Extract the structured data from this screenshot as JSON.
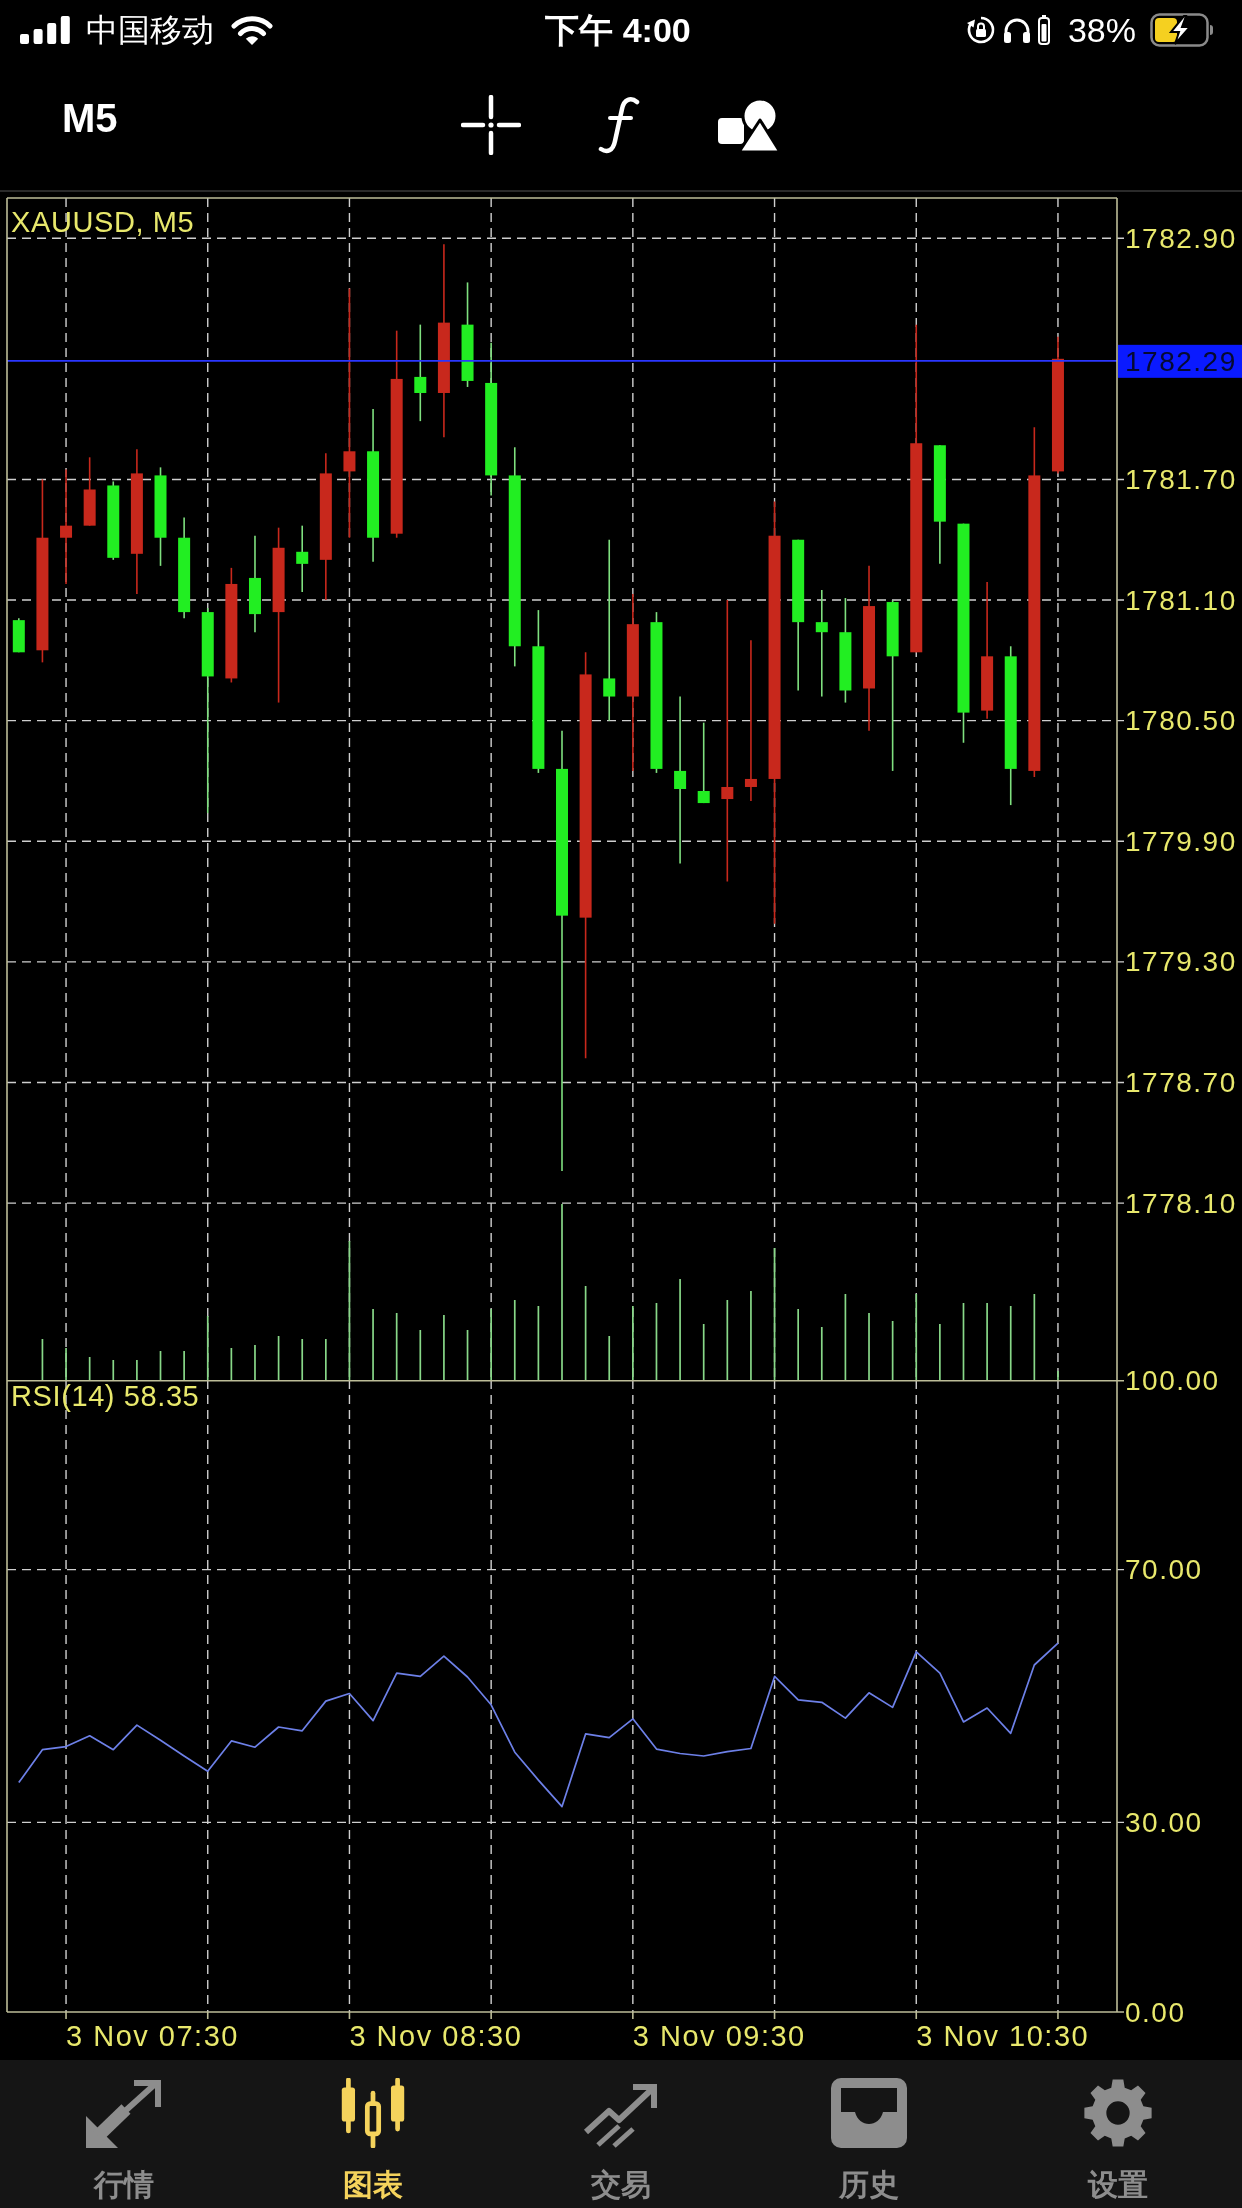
{
  "status_bar": {
    "carrier": "中国移动",
    "time": "下午 4:00",
    "battery": "38%"
  },
  "toolbar": {
    "timeframe": "M5"
  },
  "price_chart": {
    "chart_data": {
      "type": "candlestick",
      "title": "XAUUSD, M5",
      "categories": [
        null,
        null,
        null,
        null,
        null,
        null,
        null,
        null,
        null,
        null,
        null,
        null,
        null,
        null,
        null,
        null,
        null,
        null,
        null,
        null,
        null,
        null,
        null,
        null,
        null,
        null,
        null,
        null,
        null,
        null,
        null,
        null,
        null,
        null,
        null,
        null,
        null,
        null,
        null,
        null,
        null,
        null,
        null,
        null,
        null,
        null,
        null
      ],
      "ohlc": [
        [
          1780.84,
          1781.01,
          1780.84,
          1781.0
        ],
        [
          1781.41,
          1781.7,
          1780.79,
          1780.85
        ],
        [
          1781.47,
          1781.75,
          1781.18,
          1781.41
        ],
        [
          1781.65,
          1781.81,
          1781.47,
          1781.47
        ],
        [
          1781.31,
          1781.69,
          1781.3,
          1781.67
        ],
        [
          1781.73,
          1781.85,
          1781.13,
          1781.33
        ],
        [
          1781.41,
          1781.76,
          1781.27,
          1781.72
        ],
        [
          1781.04,
          1781.51,
          1781.01,
          1781.41
        ],
        [
          1780.72,
          1781.06,
          1780.04,
          1781.04
        ],
        [
          1781.18,
          1781.26,
          1780.69,
          1780.71
        ],
        [
          1781.03,
          1781.42,
          1780.94,
          1781.21
        ],
        [
          1781.36,
          1781.46,
          1780.59,
          1781.04
        ],
        [
          1781.28,
          1781.47,
          1781.14,
          1781.34
        ],
        [
          1781.73,
          1781.83,
          1781.1,
          1781.3
        ],
        [
          1781.84,
          1782.65,
          1781.41,
          1781.74
        ],
        [
          1781.41,
          1782.05,
          1781.29,
          1781.84
        ],
        [
          1782.2,
          1782.44,
          1781.41,
          1781.43
        ],
        [
          1782.13,
          1782.47,
          1781.99,
          1782.21
        ],
        [
          1782.48,
          1782.87,
          1781.91,
          1782.13
        ],
        [
          1782.19,
          1782.68,
          1782.16,
          1782.47
        ],
        [
          1781.72,
          1782.38,
          1781.62,
          1782.18
        ],
        [
          1780.87,
          1781.86,
          1780.77,
          1781.72
        ],
        [
          1780.26,
          1781.05,
          1780.24,
          1780.87
        ],
        [
          1779.53,
          1780.45,
          1778.26,
          1780.26
        ],
        [
          1780.73,
          1780.84,
          1778.82,
          1779.52
        ],
        [
          1780.62,
          1781.4,
          1780.5,
          1780.71
        ],
        [
          1780.98,
          1781.13,
          1780.25,
          1780.62
        ],
        [
          1780.26,
          1781.04,
          1780.24,
          1780.99
        ],
        [
          1780.16,
          1780.62,
          1779.79,
          1780.25
        ],
        [
          1780.09,
          1780.49,
          1780.09,
          1780.15
        ],
        [
          1780.17,
          1781.1,
          1779.7,
          1780.11
        ],
        [
          1780.21,
          1780.9,
          1780.1,
          1780.17
        ],
        [
          1781.42,
          1781.59,
          1779.49,
          1780.21
        ],
        [
          1780.99,
          1781.4,
          1780.65,
          1781.4
        ],
        [
          1780.94,
          1781.15,
          1780.62,
          1780.99
        ],
        [
          1780.65,
          1781.11,
          1780.59,
          1780.94
        ],
        [
          1781.07,
          1781.27,
          1780.45,
          1780.66
        ],
        [
          1780.82,
          1781.1,
          1780.25,
          1781.09
        ],
        [
          1781.88,
          1782.47,
          1780.84,
          1780.84
        ],
        [
          1781.49,
          1781.87,
          1781.28,
          1781.87
        ],
        [
          1780.54,
          1781.48,
          1780.39,
          1781.48
        ],
        [
          1780.82,
          1781.19,
          1780.51,
          1780.55
        ],
        [
          1780.26,
          1780.87,
          1780.08,
          1780.82
        ],
        [
          1781.72,
          1781.96,
          1780.22,
          1780.25
        ],
        [
          1782.3,
          1782.41,
          1781.73,
          1781.74
        ],
        null,
        null
      ],
      "ylim": [
        1777.22,
        1783.1
      ],
      "yticks": [
        {
          "value": 1782.9,
          "label": "1782.90"
        },
        {
          "value": 1781.7,
          "label": "1781.70"
        },
        {
          "value": 1781.1,
          "label": "1781.10"
        },
        {
          "value": 1780.5,
          "label": "1780.50"
        },
        {
          "value": 1779.9,
          "label": "1779.90"
        },
        {
          "value": 1779.3,
          "label": "1779.30"
        },
        {
          "value": 1778.7,
          "label": "1778.70"
        },
        {
          "value": 1778.1,
          "label": "1778.10"
        }
      ],
      "grid": true,
      "ref_lines": [
        {
          "axis": "y",
          "value": 1782.29,
          "label": "1782.29"
        }
      ]
    }
  },
  "rsi_chart": {
    "chart_data": {
      "type": "line",
      "title": "RSI(14) 58.35",
      "categories": [
        null,
        null,
        null,
        null,
        null,
        null,
        null,
        null,
        null,
        null,
        null,
        null,
        null,
        null,
        null,
        null,
        null,
        null,
        null,
        null,
        null,
        null,
        null,
        null,
        null,
        null,
        null,
        null,
        null,
        null,
        null,
        null,
        null,
        null,
        null,
        null,
        null,
        null,
        null,
        null,
        null,
        null,
        null,
        null,
        null,
        null,
        null
      ],
      "series": [
        {
          "values": [
            36.3,
            41.5,
            42.0,
            43.7,
            41.5,
            45.4,
            43.0,
            40.5,
            38.1,
            42.9,
            41.9,
            45.1,
            44.5,
            49.2,
            50.4,
            46.1,
            53.6,
            53.1,
            56.3,
            53.0,
            48.6,
            41.1,
            36.7,
            32.5,
            44.0,
            43.4,
            46.4,
            41.6,
            40.9,
            40.5,
            41.2,
            41.7,
            53.1,
            49.4,
            49.0,
            46.5,
            50.5,
            48.2,
            57.0,
            53.6,
            45.9,
            48.1,
            44.1,
            54.9,
            58.35,
            null,
            null
          ]
        }
      ],
      "ylim": [
        0,
        100
      ],
      "yticks": [
        {
          "value": 100,
          "label": "100.00"
        },
        {
          "value": 70,
          "label": "70.00"
        },
        {
          "value": 30,
          "label": "30.00"
        },
        {
          "value": 0,
          "label": "0.00"
        }
      ],
      "grid": true
    }
  },
  "time_axis": {
    "labels": [
      "3 Nov 07:30",
      "3 Nov 08:30",
      "3 Nov 09:30",
      "3 Nov 10:30"
    ]
  },
  "tab_bar": [
    {
      "label": "行情",
      "selected": false
    },
    {
      "label": "图表",
      "selected": true
    },
    {
      "label": "交易",
      "selected": false
    },
    {
      "label": "历史",
      "selected": false
    },
    {
      "label": "设置",
      "selected": false
    }
  ]
}
